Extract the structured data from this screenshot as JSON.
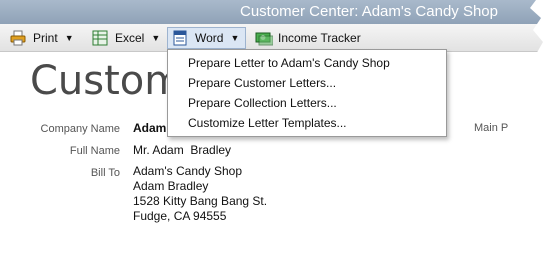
{
  "window": {
    "title": "Customer Center: Adam's Candy Shop"
  },
  "toolbar": {
    "print": {
      "label": "Print",
      "icon": "printer-icon"
    },
    "excel": {
      "label": "Excel",
      "icon": "excel-icon"
    },
    "word": {
      "label": "Word",
      "icon": "word-icon"
    },
    "income_tracker": {
      "label": "Income Tracker",
      "icon": "income-tracker-icon"
    }
  },
  "word_menu": {
    "items": [
      {
        "label": "Prepare Letter to Adam's Candy Shop"
      },
      {
        "label": "Prepare Customer Letters..."
      },
      {
        "label": "Prepare Collection Letters..."
      },
      {
        "label": "Customize Letter Templates..."
      }
    ]
  },
  "customer": {
    "page_title": "Customer",
    "company_name_label": "Company Name",
    "company_name_value": "Adam",
    "main_label": "Main P",
    "full_name_label": "Full Name",
    "full_name_value": "Mr. Adam  Bradley",
    "bill_to_label": "Bill To",
    "bill_to_lines": [
      "Adam's Candy Shop",
      "Adam Bradley",
      "1528 Kitty Bang Bang St.",
      "Fudge, CA 94555"
    ]
  },
  "colors": {
    "titlebar": "#9aabbe",
    "menu_highlight": "#dbe6f4"
  }
}
